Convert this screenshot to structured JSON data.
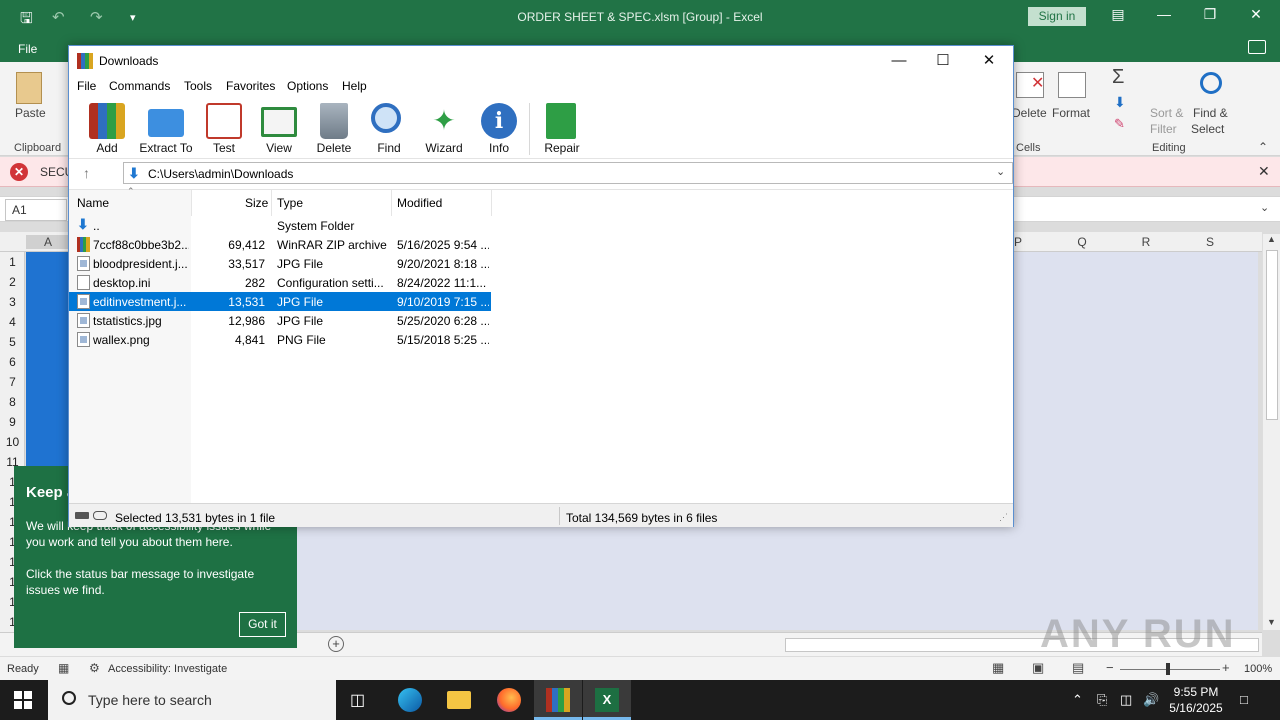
{
  "excel": {
    "title": "ORDER SHEET & SPEC.xlsm  [Group]  -  Excel",
    "sign_in": "Sign in",
    "tab_file": "File",
    "ribbon": {
      "paste": "Paste",
      "clipboard": "Clipboard",
      "delete": "Delete",
      "format": "Format",
      "cells": "Cells",
      "sort_filter_1": "Sort &",
      "sort_filter_2": "Filter",
      "find_select_1": "Find &",
      "find_select_2": "Select",
      "editing": "Editing"
    },
    "security_bar": "SECU",
    "name_box": "A1",
    "columns": [
      "A",
      "P",
      "Q",
      "R",
      "S"
    ],
    "rows": [
      "1",
      "2",
      "3",
      "4",
      "5",
      "6",
      "7",
      "8",
      "9",
      "10",
      "11",
      "1",
      "1",
      "1",
      "1",
      "1",
      "1",
      "1",
      "1"
    ],
    "status_ready": "Ready",
    "status_accessibility": "Accessibility: Investigate",
    "zoom": "100%",
    "watermark": "ANY RUN"
  },
  "accessibility_tip": {
    "title": "Keep a",
    "body_1": "We will keep track of accessibility issues while you work and tell you about them here.",
    "body_2": "Click the status bar message to investigate issues we find.",
    "button": "Got it"
  },
  "winrar": {
    "title": "Downloads",
    "menu": [
      "File",
      "Commands",
      "Tools",
      "Favorites",
      "Options",
      "Help"
    ],
    "toolbar": [
      "Add",
      "Extract To",
      "Test",
      "View",
      "Delete",
      "Find",
      "Wizard",
      "Info",
      "Repair"
    ],
    "address": "C:\\Users\\admin\\Downloads",
    "columns": {
      "name": "Name",
      "size": "Size",
      "type": "Type",
      "modified": "Modified"
    },
    "files": [
      {
        "name": "..",
        "size": "",
        "type": "System Folder",
        "modified": "",
        "icon": "up-arrow-icon"
      },
      {
        "name": "7ccf88c0bbe3b2...",
        "size": "69,412",
        "type": "WinRAR ZIP archive",
        "modified": "5/16/2025 9:54 ...",
        "icon": "zip-archive-icon"
      },
      {
        "name": "bloodpresident.j...",
        "size": "33,517",
        "type": "JPG File",
        "modified": "9/20/2021 8:18 ...",
        "icon": "image-file-icon"
      },
      {
        "name": "desktop.ini",
        "size": "282",
        "type": "Configuration setti...",
        "modified": "8/24/2022 11:1...",
        "icon": "settings-file-icon"
      },
      {
        "name": "editinvestment.j...",
        "size": "13,531",
        "type": "JPG File",
        "modified": "9/10/2019 7:15 ...",
        "icon": "image-file-icon",
        "selected": true
      },
      {
        "name": "tstatistics.jpg",
        "size": "12,986",
        "type": "JPG File",
        "modified": "5/25/2020 6:28 ...",
        "icon": "image-file-icon"
      },
      {
        "name": "wallex.png",
        "size": "4,841",
        "type": "PNG File",
        "modified": "5/15/2018 5:25 ...",
        "icon": "image-file-icon"
      }
    ],
    "status_left": "Selected 13,531 bytes in 1 file",
    "status_right": "Total 134,569 bytes in 6 files"
  },
  "taskbar": {
    "search_placeholder": "Type here to search",
    "time": "9:55 PM",
    "date": "5/16/2025"
  }
}
